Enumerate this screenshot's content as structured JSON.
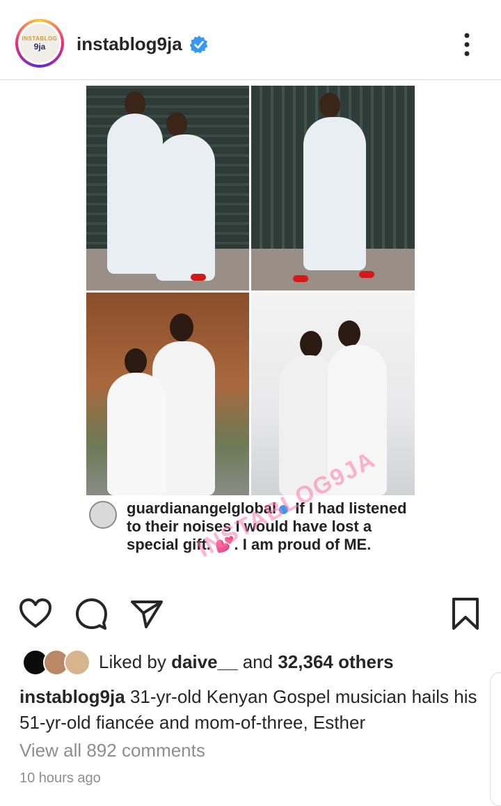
{
  "header": {
    "username": "instablog9ja",
    "avatar_text_top": "INSTABLOG",
    "avatar_text_bottom": "9ja",
    "verified_icon": "verified-badge-icon",
    "more_icon": "more-vertical-icon"
  },
  "post": {
    "quote": {
      "author": "guardianangelglobal",
      "text": "If I had listened to their noises I would have lost a special gift. 💕. I am proud of ME."
    },
    "watermark": "INSTABLOG9JA"
  },
  "actions": {
    "like_icon": "heart-icon",
    "comment_icon": "comment-icon",
    "share_icon": "send-icon",
    "save_icon": "bookmark-icon"
  },
  "likes": {
    "prefix": "Liked by",
    "user": "daive__",
    "middle": "and",
    "count": "32,364 others"
  },
  "caption": {
    "user": "instablog9ja",
    "text": "31-yr-old Kenyan Gospel musician hails his 51-yr-old fiancée and mom-of-three, Esther"
  },
  "comments_link": "View all 892 comments",
  "timestamp": "10 hours ago",
  "colors": {
    "text": "#262626",
    "muted": "#8e8e8e",
    "verified": "#3897f0",
    "shoe_red": "#d21a1a"
  }
}
